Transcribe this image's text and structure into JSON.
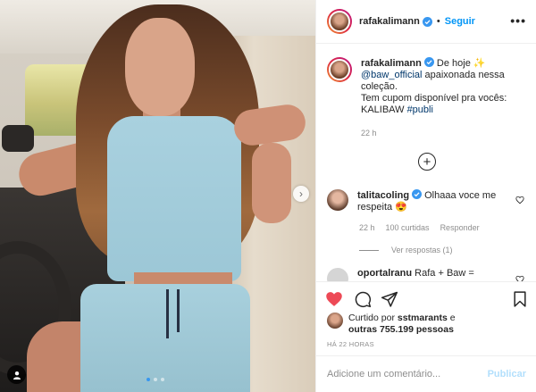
{
  "post": {
    "username": "rafakalimann",
    "follow_label": "Seguir",
    "separator": "•",
    "more_label": "•••",
    "caption": {
      "username": "rafakalimann",
      "text_1": " De hoje ✨",
      "mention": "@baw_official",
      "text_2": " apaixonada nessa coleção.",
      "text_3": "Tem cupom disponível pra vocês: KALIBAW ",
      "hashtag": "#publi",
      "time": "22 h"
    },
    "load_more_label": "+",
    "comments": [
      {
        "username": "talitacoling",
        "text": " Olhaaa voce me respeita 😍",
        "time": "22 h",
        "likes": "100 curtidas",
        "reply_label": "Responder",
        "view_replies": "Ver respostas (1)"
      },
      {
        "username": "oportalranu",
        "text": " Rafa + Baw ="
      }
    ],
    "likes": {
      "prefix": "Curtido por ",
      "by_user": "sstmarants",
      "middle": " e",
      "count_text": "outras 755.199 pessoas"
    },
    "time_ago": "HÁ 22 HORAS",
    "comment_placeholder": "Adicione um comentário...",
    "publish_label": "Publicar",
    "carousel": {
      "total": 3,
      "active_index": 0
    },
    "colors": {
      "accent": "#0095f6",
      "like": "#ed4956",
      "publish_disabled": "#b2dffc"
    }
  }
}
